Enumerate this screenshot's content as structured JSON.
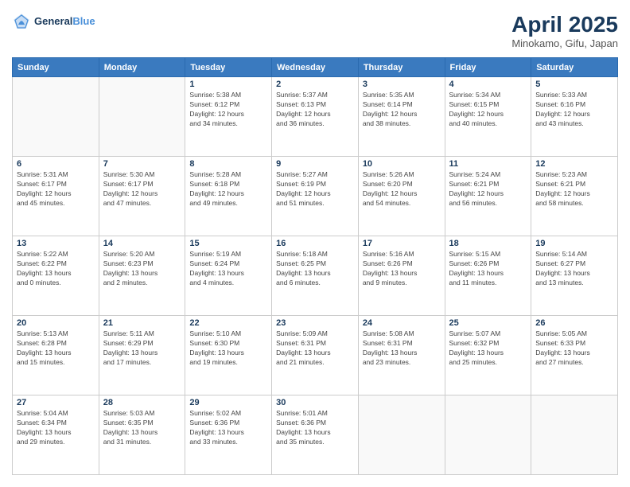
{
  "header": {
    "logo_line1": "General",
    "logo_line2": "Blue",
    "month": "April 2025",
    "location": "Minokamo, Gifu, Japan"
  },
  "days_of_week": [
    "Sunday",
    "Monday",
    "Tuesday",
    "Wednesday",
    "Thursday",
    "Friday",
    "Saturday"
  ],
  "weeks": [
    [
      {
        "day": "",
        "info": "",
        "empty": true
      },
      {
        "day": "",
        "info": "",
        "empty": true
      },
      {
        "day": "1",
        "info": "Sunrise: 5:38 AM\nSunset: 6:12 PM\nDaylight: 12 hours\nand 34 minutes."
      },
      {
        "day": "2",
        "info": "Sunrise: 5:37 AM\nSunset: 6:13 PM\nDaylight: 12 hours\nand 36 minutes."
      },
      {
        "day": "3",
        "info": "Sunrise: 5:35 AM\nSunset: 6:14 PM\nDaylight: 12 hours\nand 38 minutes."
      },
      {
        "day": "4",
        "info": "Sunrise: 5:34 AM\nSunset: 6:15 PM\nDaylight: 12 hours\nand 40 minutes."
      },
      {
        "day": "5",
        "info": "Sunrise: 5:33 AM\nSunset: 6:16 PM\nDaylight: 12 hours\nand 43 minutes."
      }
    ],
    [
      {
        "day": "6",
        "info": "Sunrise: 5:31 AM\nSunset: 6:17 PM\nDaylight: 12 hours\nand 45 minutes."
      },
      {
        "day": "7",
        "info": "Sunrise: 5:30 AM\nSunset: 6:17 PM\nDaylight: 12 hours\nand 47 minutes."
      },
      {
        "day": "8",
        "info": "Sunrise: 5:28 AM\nSunset: 6:18 PM\nDaylight: 12 hours\nand 49 minutes."
      },
      {
        "day": "9",
        "info": "Sunrise: 5:27 AM\nSunset: 6:19 PM\nDaylight: 12 hours\nand 51 minutes."
      },
      {
        "day": "10",
        "info": "Sunrise: 5:26 AM\nSunset: 6:20 PM\nDaylight: 12 hours\nand 54 minutes."
      },
      {
        "day": "11",
        "info": "Sunrise: 5:24 AM\nSunset: 6:21 PM\nDaylight: 12 hours\nand 56 minutes."
      },
      {
        "day": "12",
        "info": "Sunrise: 5:23 AM\nSunset: 6:21 PM\nDaylight: 12 hours\nand 58 minutes."
      }
    ],
    [
      {
        "day": "13",
        "info": "Sunrise: 5:22 AM\nSunset: 6:22 PM\nDaylight: 13 hours\nand 0 minutes."
      },
      {
        "day": "14",
        "info": "Sunrise: 5:20 AM\nSunset: 6:23 PM\nDaylight: 13 hours\nand 2 minutes."
      },
      {
        "day": "15",
        "info": "Sunrise: 5:19 AM\nSunset: 6:24 PM\nDaylight: 13 hours\nand 4 minutes."
      },
      {
        "day": "16",
        "info": "Sunrise: 5:18 AM\nSunset: 6:25 PM\nDaylight: 13 hours\nand 6 minutes."
      },
      {
        "day": "17",
        "info": "Sunrise: 5:16 AM\nSunset: 6:26 PM\nDaylight: 13 hours\nand 9 minutes."
      },
      {
        "day": "18",
        "info": "Sunrise: 5:15 AM\nSunset: 6:26 PM\nDaylight: 13 hours\nand 11 minutes."
      },
      {
        "day": "19",
        "info": "Sunrise: 5:14 AM\nSunset: 6:27 PM\nDaylight: 13 hours\nand 13 minutes."
      }
    ],
    [
      {
        "day": "20",
        "info": "Sunrise: 5:13 AM\nSunset: 6:28 PM\nDaylight: 13 hours\nand 15 minutes."
      },
      {
        "day": "21",
        "info": "Sunrise: 5:11 AM\nSunset: 6:29 PM\nDaylight: 13 hours\nand 17 minutes."
      },
      {
        "day": "22",
        "info": "Sunrise: 5:10 AM\nSunset: 6:30 PM\nDaylight: 13 hours\nand 19 minutes."
      },
      {
        "day": "23",
        "info": "Sunrise: 5:09 AM\nSunset: 6:31 PM\nDaylight: 13 hours\nand 21 minutes."
      },
      {
        "day": "24",
        "info": "Sunrise: 5:08 AM\nSunset: 6:31 PM\nDaylight: 13 hours\nand 23 minutes."
      },
      {
        "day": "25",
        "info": "Sunrise: 5:07 AM\nSunset: 6:32 PM\nDaylight: 13 hours\nand 25 minutes."
      },
      {
        "day": "26",
        "info": "Sunrise: 5:05 AM\nSunset: 6:33 PM\nDaylight: 13 hours\nand 27 minutes."
      }
    ],
    [
      {
        "day": "27",
        "info": "Sunrise: 5:04 AM\nSunset: 6:34 PM\nDaylight: 13 hours\nand 29 minutes."
      },
      {
        "day": "28",
        "info": "Sunrise: 5:03 AM\nSunset: 6:35 PM\nDaylight: 13 hours\nand 31 minutes."
      },
      {
        "day": "29",
        "info": "Sunrise: 5:02 AM\nSunset: 6:36 PM\nDaylight: 13 hours\nand 33 minutes."
      },
      {
        "day": "30",
        "info": "Sunrise: 5:01 AM\nSunset: 6:36 PM\nDaylight: 13 hours\nand 35 minutes."
      },
      {
        "day": "",
        "info": "",
        "empty": true
      },
      {
        "day": "",
        "info": "",
        "empty": true
      },
      {
        "day": "",
        "info": "",
        "empty": true
      }
    ]
  ]
}
